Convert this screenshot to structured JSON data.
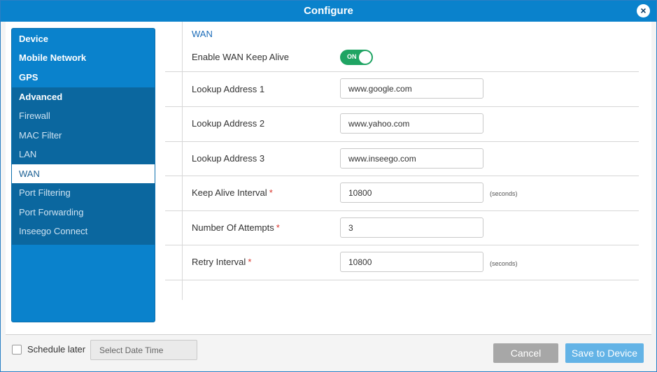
{
  "dialog": {
    "title": "Configure",
    "close_icon": "×"
  },
  "sidebar": {
    "top_items": [
      "Device",
      "Mobile Network",
      "GPS",
      "Advanced"
    ],
    "sub_items": [
      "Firewall",
      "MAC Filter",
      "LAN",
      "WAN",
      "Port Filtering",
      "Port Forwarding",
      "Inseego Connect"
    ],
    "active": "WAN"
  },
  "wan": {
    "section_title": "WAN",
    "keep_alive": {
      "label": "Enable WAN Keep Alive",
      "state": "ON"
    },
    "lookup1": {
      "label": "Lookup Address 1",
      "value": "www.google.com"
    },
    "lookup2": {
      "label": "Lookup Address 2",
      "value": "www.yahoo.com"
    },
    "lookup3": {
      "label": "Lookup Address 3",
      "value": "www.inseego.com"
    },
    "interval": {
      "label": "Keep Alive Interval",
      "required": "*",
      "value": "10800",
      "suffix": "(seconds)"
    },
    "attempts": {
      "label": "Number Of Attempts",
      "required": "*",
      "value": "3"
    },
    "retry": {
      "label": "Retry Interval",
      "required": "*",
      "value": "10800",
      "suffix": "(seconds)"
    }
  },
  "footer": {
    "schedule_label": "Schedule later",
    "date_placeholder": "Select Date Time",
    "cancel_label": "Cancel",
    "save_label": "Save to Device"
  },
  "colors": {
    "accent": "#0a82cc",
    "toggle_on": "#1fa463",
    "required": "#d9342b"
  }
}
